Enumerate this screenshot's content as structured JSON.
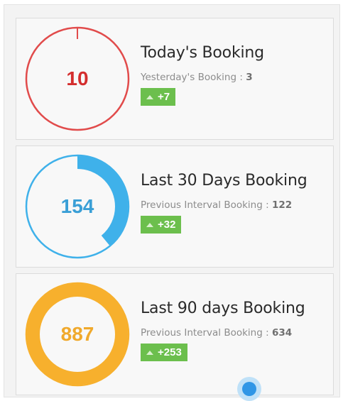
{
  "cards": [
    {
      "value": "10",
      "title": "Today's Booking",
      "prev_label": "Yesterday's Booking :",
      "prev_value": "3",
      "change": "+7",
      "color": "#e14b4b",
      "fill_fraction": 0.0,
      "change_icon": "triangle-up-icon"
    },
    {
      "value": "154",
      "title": "Last 30 Days Booking",
      "prev_label": "Previous Interval Booking :",
      "prev_value": "122",
      "change": "+32",
      "color": "#3fb1ea",
      "fill_fraction": 0.39,
      "change_icon": "triangle-up-icon"
    },
    {
      "value": "887",
      "title": "Last 90 days Booking",
      "prev_label": "Previous Interval Booking :",
      "prev_value": "634",
      "change": "+253",
      "color": "#f7b02d",
      "fill_fraction": 1.0,
      "change_icon": "triangle-up-icon"
    }
  ],
  "colors": {
    "badge": "#6cbf4d",
    "cursor_dot": "#2f96e6"
  }
}
